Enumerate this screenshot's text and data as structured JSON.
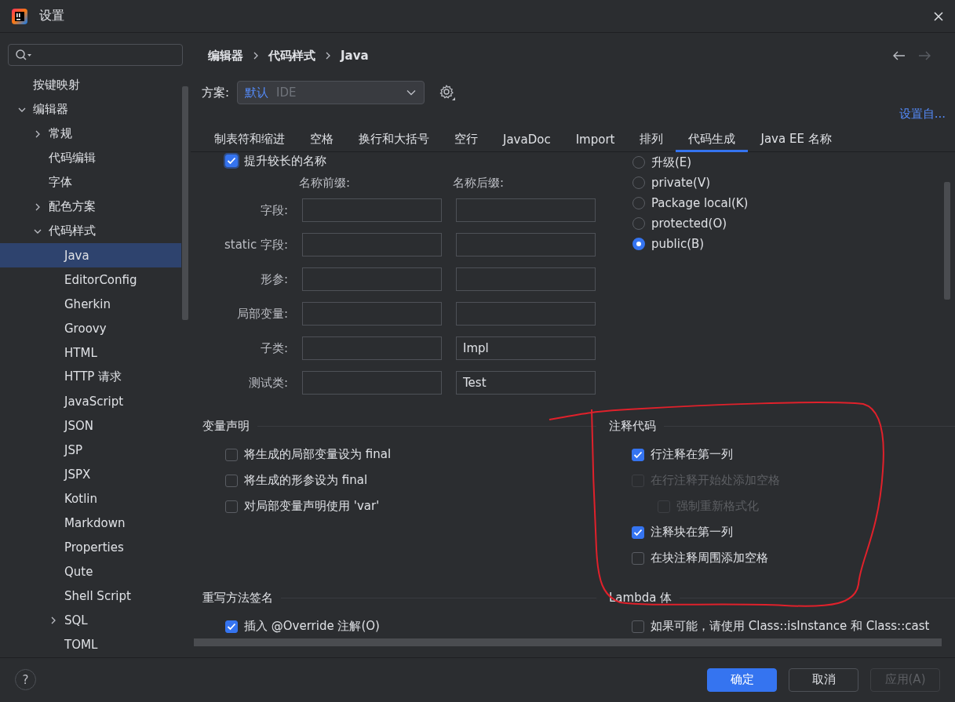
{
  "window": {
    "title": "设置"
  },
  "sidebar": {
    "items": [
      {
        "label": "按键映射",
        "selected": false
      },
      {
        "label": "编辑器",
        "selected": false,
        "expanded": true,
        "children": [
          {
            "label": "常规",
            "selected": false,
            "expanded": false
          },
          {
            "label": "代码编辑",
            "selected": false
          },
          {
            "label": "字体",
            "selected": false
          },
          {
            "label": "配色方案",
            "selected": false,
            "expanded": false
          },
          {
            "label": "代码样式",
            "selected": false,
            "expanded": true,
            "children": [
              {
                "label": "Java",
                "selected": true
              },
              {
                "label": "EditorConfig",
                "selected": false
              },
              {
                "label": "Gherkin",
                "selected": false
              },
              {
                "label": "Groovy",
                "selected": false
              },
              {
                "label": "HTML",
                "selected": false
              },
              {
                "label": "HTTP 请求",
                "selected": false
              },
              {
                "label": "JavaScript",
                "selected": false
              },
              {
                "label": "JSON",
                "selected": false
              },
              {
                "label": "JSP",
                "selected": false
              },
              {
                "label": "JSPX",
                "selected": false
              },
              {
                "label": "Kotlin",
                "selected": false
              },
              {
                "label": "Markdown",
                "selected": false
              },
              {
                "label": "Properties",
                "selected": false
              },
              {
                "label": "Qute",
                "selected": false
              },
              {
                "label": "Shell Script",
                "selected": false
              },
              {
                "label": "SQL",
                "selected": false,
                "expanded": false
              },
              {
                "label": "TOML",
                "selected": false
              }
            ]
          }
        ]
      }
    ]
  },
  "breadcrumb": [
    "编辑器",
    "代码样式",
    "Java"
  ],
  "navigation": [
    {
      "kind": "back",
      "disabled": false
    },
    {
      "kind": "forward",
      "disabled": true
    }
  ],
  "scheme": {
    "label": "方案:",
    "value": "默认",
    "note": "IDE"
  },
  "set_from_link": "设置自...",
  "tabs": [
    {
      "label": "制表符和缩进",
      "selected": false
    },
    {
      "label": "空格",
      "selected": false
    },
    {
      "label": "换行和大括号",
      "selected": false
    },
    {
      "label": "空行",
      "selected": false
    },
    {
      "label": "JavaDoc",
      "selected": false
    },
    {
      "label": "Import",
      "selected": false
    },
    {
      "label": "排列",
      "selected": false
    },
    {
      "label": "代码生成",
      "selected": true
    },
    {
      "label": "Java EE 名称",
      "selected": false
    }
  ],
  "naming": {
    "option": {
      "label": "提升较长的名称",
      "checked": true
    },
    "columns": [
      "名称前缀:",
      "名称后缀:"
    ],
    "rows": [
      {
        "label": "字段:"
      },
      {
        "label": "static 字段:"
      },
      {
        "label": "形参:"
      },
      {
        "label": "局部变量:"
      },
      {
        "label": "子类:",
        "suffix": "Impl"
      },
      {
        "label": "测试类:",
        "suffix": "Test"
      }
    ]
  },
  "visibility": [
    {
      "label": "升级(E)",
      "selected": false
    },
    {
      "label": "private(V)",
      "selected": false
    },
    {
      "label": "Package local(K)",
      "selected": false
    },
    {
      "label": "protected(O)",
      "selected": false
    },
    {
      "label": "public(B)",
      "selected": true
    }
  ],
  "sections": [
    {
      "title": "变量声明",
      "options": [
        {
          "label": "将生成的局部变量设为 final",
          "checked": false,
          "disabled": false
        },
        {
          "label": "将生成的形参设为 final",
          "checked": false,
          "disabled": false
        },
        {
          "label": "对局部变量声明使用 'var'",
          "checked": false,
          "disabled": false
        }
      ]
    },
    {
      "title": "注释代码",
      "options": [
        {
          "label": "行注释在第一列",
          "checked": true,
          "disabled": false
        },
        {
          "label": "在行注释开始处添加空格",
          "checked": false,
          "disabled": true,
          "children": [
            {
              "label": "强制重新格式化",
              "checked": false,
              "disabled": true
            }
          ]
        },
        {
          "label": "注释块在第一列",
          "checked": true,
          "disabled": false
        },
        {
          "label": "在块注释周围添加空格",
          "checked": false,
          "disabled": false
        }
      ]
    },
    {
      "title": "重写方法签名",
      "options": [
        {
          "label": "插入 @Override 注解(O)",
          "checked": true,
          "disabled": false
        }
      ]
    },
    {
      "title": "Lambda 体",
      "options": [
        {
          "label": "如果可能，请使用 Class::isInstance 和 Class::cast",
          "checked": false,
          "disabled": false
        }
      ]
    }
  ],
  "help": "?",
  "buttons": [
    {
      "label": "确定",
      "kind": "primary",
      "disabled": false
    },
    {
      "label": "取消",
      "kind": "secondary",
      "disabled": false
    },
    {
      "label": "应用(A)",
      "kind": "secondary",
      "disabled": true
    }
  ]
}
